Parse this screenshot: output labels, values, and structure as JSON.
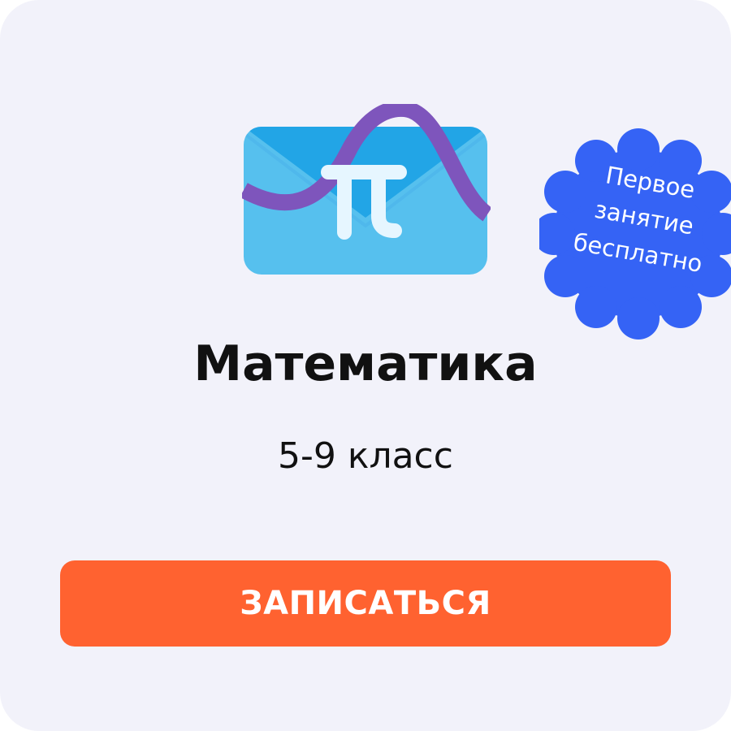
{
  "course": {
    "title": "Математика",
    "grade": "5-9 класс"
  },
  "badge": {
    "line1": "Первое",
    "line2": "занятие",
    "line3": "бесплатно",
    "color": "#3563F5"
  },
  "cta": {
    "label": "ЗАПИСАТЬСЯ",
    "color": "#FF6230"
  },
  "illustration": {
    "icon": "pi-envelope-icon",
    "wave_icon": "sine-wave-icon"
  },
  "colors": {
    "background": "#F2F2FA",
    "envelope": "#56C0EE",
    "envelope_flap": "#22A5E6",
    "wave": "#7E55BC",
    "pi": "#E6F6FF"
  }
}
